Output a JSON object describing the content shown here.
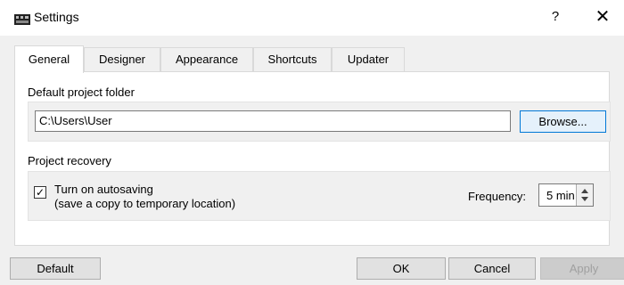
{
  "window": {
    "title": "Settings",
    "help_label": "?",
    "close_label": "✕",
    "icon": "app-icon"
  },
  "tabs": [
    {
      "label": "General",
      "active": true
    },
    {
      "label": "Designer",
      "active": false
    },
    {
      "label": "Appearance",
      "active": false
    },
    {
      "label": "Shortcuts",
      "active": false
    },
    {
      "label": "Updater",
      "active": false
    }
  ],
  "general": {
    "default_folder_label": "Default project folder",
    "folder_path": "C:\\Users\\User",
    "browse_label": "Browse...",
    "recovery_label": "Project recovery",
    "autosave_label_line1": "Turn on autosaving",
    "autosave_label_line2": "(save a copy to temporary location)",
    "autosave_checked": true,
    "frequency_label": "Frequency:",
    "frequency_value": "5 min"
  },
  "footer": {
    "default_label": "Default",
    "ok_label": "OK",
    "cancel_label": "Cancel",
    "apply_label": "Apply"
  },
  "colors": {
    "focus_border": "#0078d7",
    "window_bg": "#f0f0f0"
  }
}
